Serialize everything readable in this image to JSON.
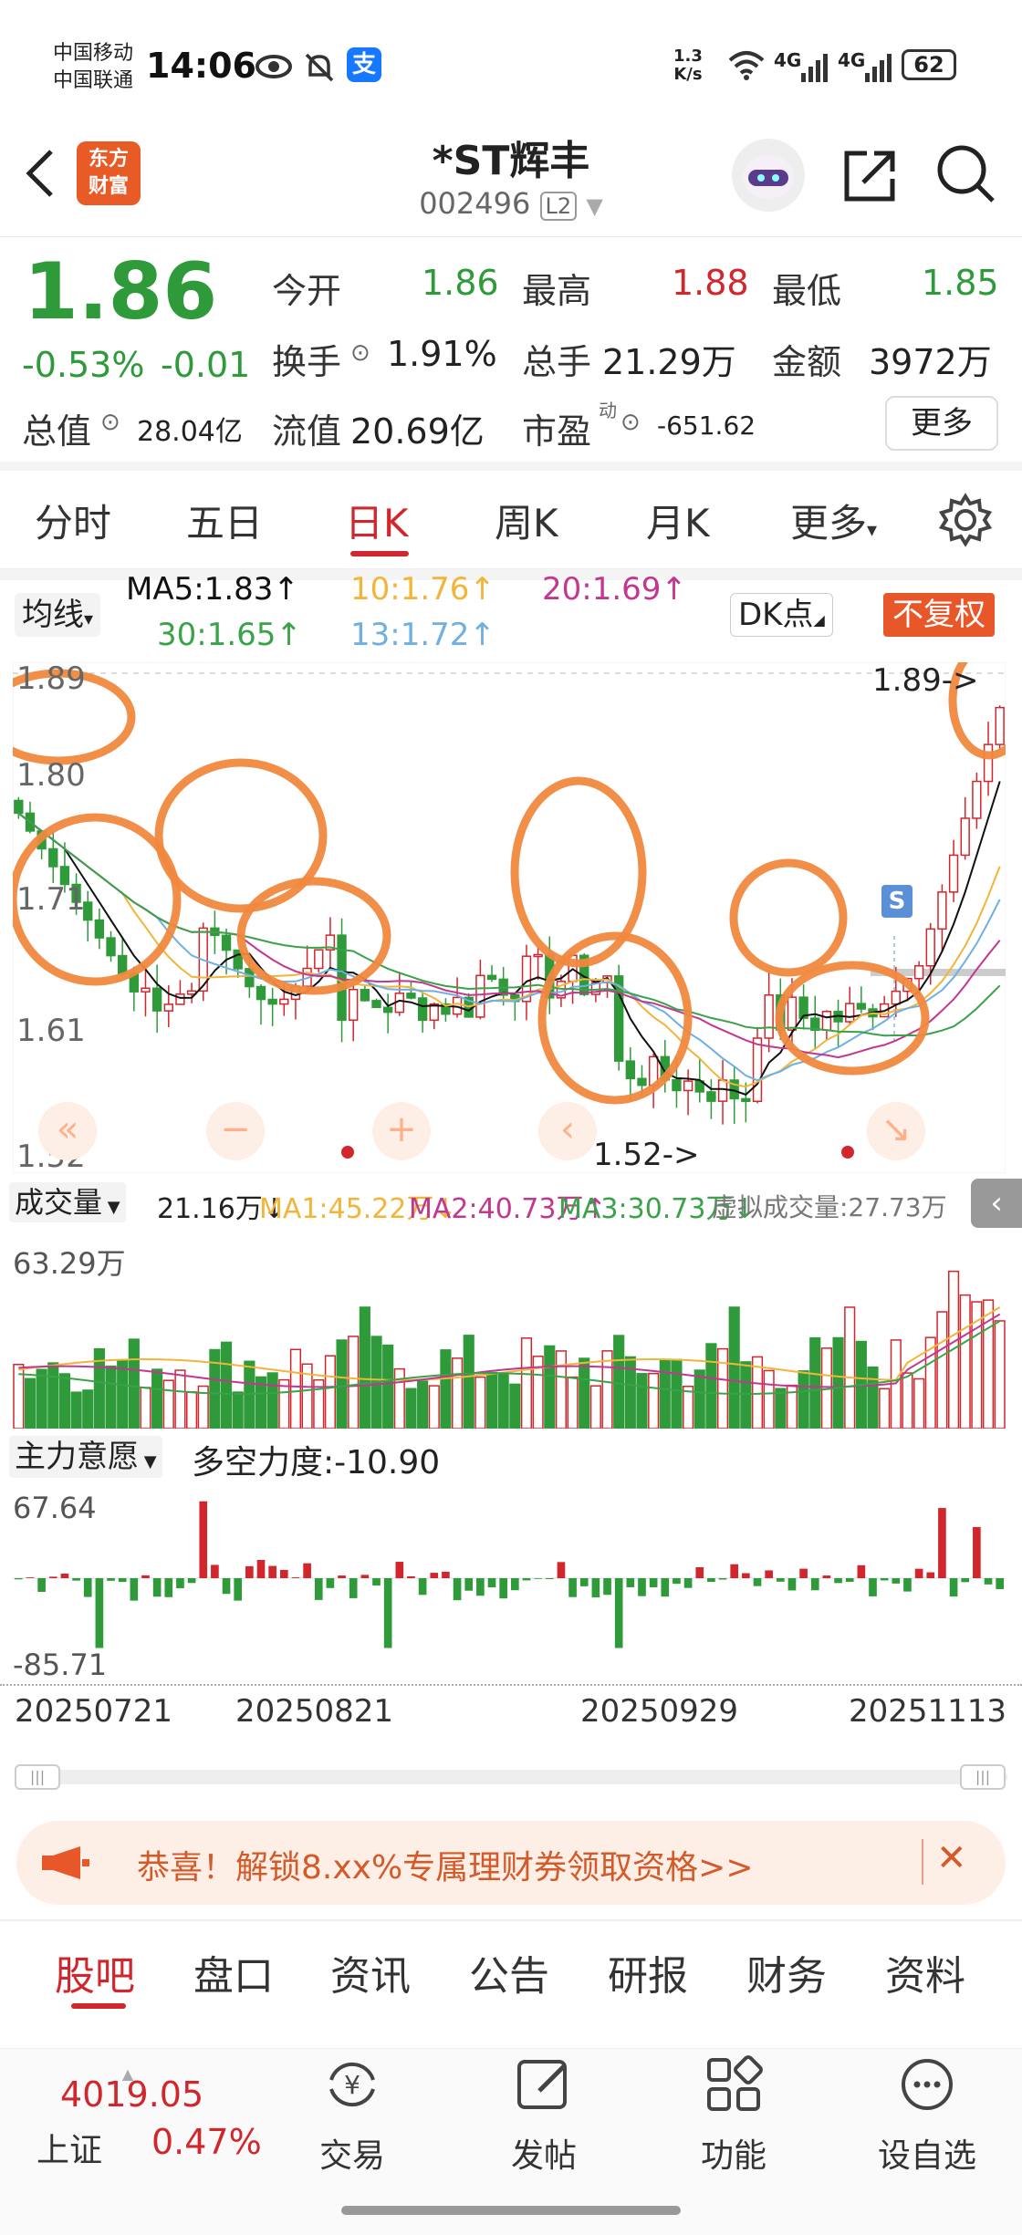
{
  "status_bar": {
    "carrier_1": "中国移动",
    "carrier_2": "中国联通",
    "time": "14:06",
    "net_speed_value": "1.3",
    "net_speed_unit": "K/s",
    "signal_1": "4G",
    "signal_2": "4G",
    "battery": "62",
    "alipay_badge": "支"
  },
  "header": {
    "title": "*ST辉丰",
    "code": "002496",
    "level_badge": "L2",
    "logo_line1": "东方",
    "logo_line2": "财富",
    "icons": [
      "back-arrow-icon",
      "robot-avatar-icon",
      "share-icon",
      "search-icon"
    ]
  },
  "quote": {
    "price": "1.86",
    "change_pct": "-0.53%",
    "change_abs": "-0.01",
    "open_label": "今开",
    "open": "1.86",
    "high_label": "最高",
    "high": "1.88",
    "low_label": "最低",
    "low": "1.85",
    "turnover_label": "换手",
    "turnover": "1.91%",
    "volume_label": "总手",
    "volume": "21.29万",
    "amount_label": "金额",
    "amount": "3972万",
    "mktcap_label": "总值",
    "mktcap": "28.04亿",
    "float_label": "流值",
    "float_cap": "20.69亿",
    "pe_label": "市盈",
    "pe_sup": "动",
    "pe": "-651.62",
    "more_button": "更多"
  },
  "period_tabs": [
    "分时",
    "五日",
    "日K",
    "周K",
    "月K",
    "更多"
  ],
  "active_period": "日K",
  "ma_bar": {
    "ma_select": "均线",
    "ma5": "MA5:1.83↑",
    "ma10": "10:1.76↑",
    "ma20": "20:1.69↑",
    "ma30": "30:1.65↑",
    "ma13": "13:1.72↑",
    "dk_button": "DK点",
    "fq_button": "不复权"
  },
  "kline": {
    "y_top": "1.89",
    "y_1": "1.80",
    "y_2": "1.71",
    "y_3": "1.61",
    "y_bottom": "1.52",
    "max_marker": "1.89->",
    "min_marker": "1.52->",
    "s_marker": "S",
    "nav_prev": "«",
    "nav_minus": "−",
    "nav_plus": "+",
    "nav_left": "‹",
    "nav_expand": "↘"
  },
  "volume_panel": {
    "select": "成交量",
    "current": "21.16万↓",
    "ma1": "MA1:45.22万↓",
    "ma2": "MA2:40.73万↑",
    "ma3": "MA3:30.73万↓",
    "virtual": "虚拟成交量:27.73万",
    "max_label": "63.29万"
  },
  "force_panel": {
    "select": "主力意愿",
    "value": "多空力度:-10.90",
    "max_label": "67.64",
    "min_label": "-85.71"
  },
  "dates": [
    "20250721",
    "20250821",
    "20250929",
    "20251113"
  ],
  "banner": {
    "text": "恭喜！解锁8.xx%专属理财券领取资格>>",
    "close": "✕"
  },
  "bottom_tabs": [
    "股吧",
    "盘口",
    "资讯",
    "公告",
    "研报",
    "财务",
    "资料"
  ],
  "active_bottom_tab": "股吧",
  "bottom_nav": {
    "index_value": "4019.05",
    "index_name": "上证",
    "index_change": "0.47%",
    "items": [
      {
        "label": "交易",
        "icon": "yuan-exchange-icon"
      },
      {
        "label": "发帖",
        "icon": "edit-post-icon"
      },
      {
        "label": "功能",
        "icon": "grid-apps-icon"
      },
      {
        "label": "设自选",
        "icon": "more-dots-icon"
      }
    ]
  },
  "colors": {
    "up": "#d2262d",
    "down": "#2e9a3a",
    "ma5": "#111111",
    "ma10": "#f2b53a",
    "ma20": "#c2378f",
    "ma30": "#3aa34a",
    "ma13": "#6fb0e0",
    "annotation": "#f0883e"
  }
}
